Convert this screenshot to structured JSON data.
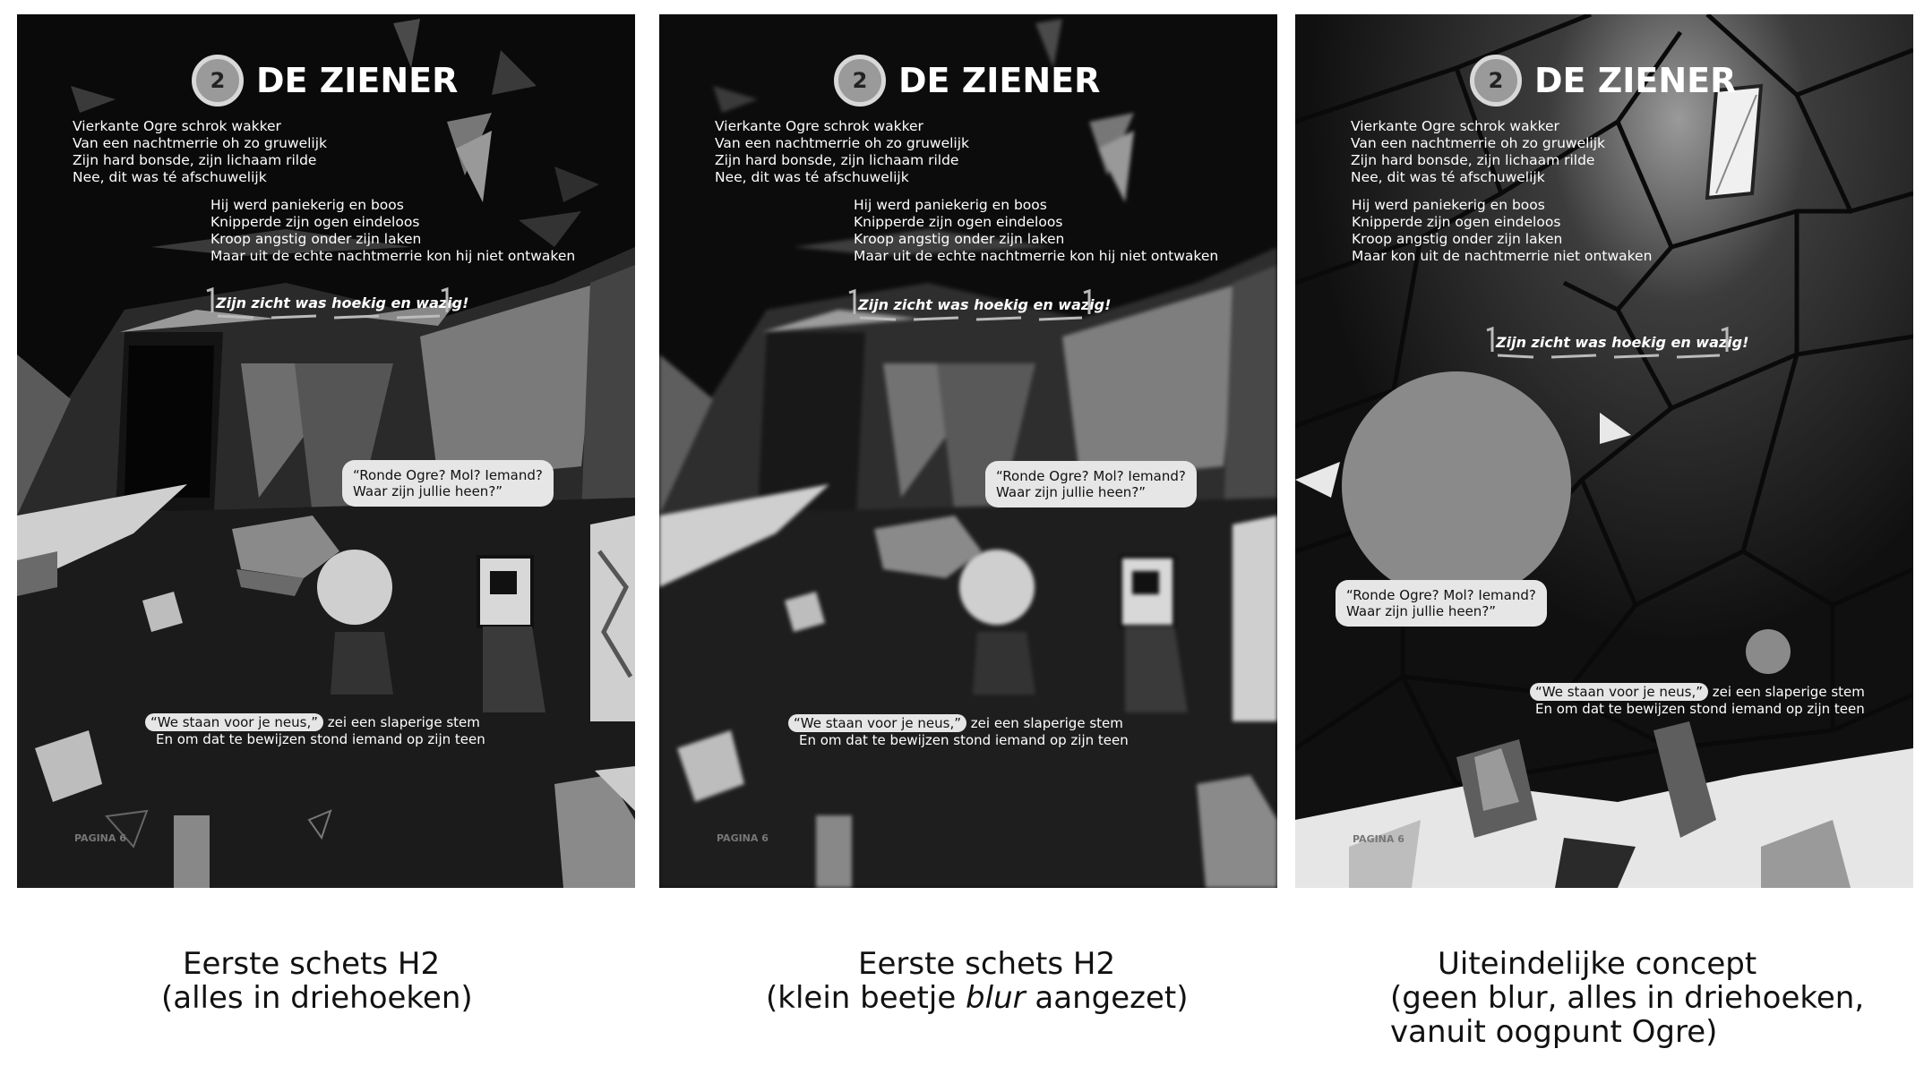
{
  "panels": [
    {
      "title": "DE ZIENER",
      "chapter": "2",
      "verse1": [
        "Vierkante Ogre schrok wakker",
        "Van een nachtmerrie oh zo gruwelijk",
        "Zijn hard bonsde, zijn lichaam rilde",
        "Nee, dit was té afschuwelijk"
      ],
      "verse2": [
        "Hij werd paniekerig en boos",
        "Knipperde zijn ogen eindeloos",
        "Kroop angstig onder zijn laken",
        "Maar uit de echte nachtmerrie kon hij niet ontwaken"
      ],
      "caption": "Zijn zicht was hoekig en wazig!",
      "bubble": [
        "“Ronde Ogre? Mol? Iemand?",
        "Waar zijn jullie heen?”"
      ],
      "narr_highlight": "“We staan voor je neus,”",
      "narr_line1_rest": " zei een slaperige stem",
      "narr_line2": "En om dat te bewijzen stond iemand op zijn teen",
      "page": "PAGINA 6"
    },
    {
      "title": "DE ZIENER",
      "chapter": "2",
      "verse1": [
        "Vierkante Ogre schrok wakker",
        "Van een nachtmerrie oh zo gruwelijk",
        "Zijn hard bonsde, zijn lichaam rilde",
        "Nee, dit was té afschuwelijk"
      ],
      "verse2": [
        "Hij werd paniekerig en boos",
        "Knipperde zijn ogen eindeloos",
        "Kroop angstig onder zijn laken",
        "Maar uit de echte nachtmerrie kon hij niet ontwaken"
      ],
      "caption": "Zijn zicht was hoekig en wazig!",
      "bubble": [
        "“Ronde Ogre? Mol? Iemand?",
        "Waar zijn jullie heen?”"
      ],
      "narr_highlight": "“We staan voor je neus,”",
      "narr_line1_rest": " zei een slaperige stem",
      "narr_line2": "En om dat te bewijzen stond iemand op zijn teen",
      "page": "PAGINA 6"
    },
    {
      "title": "DE ZIENER",
      "chapter": "2",
      "verse1": [
        "Vierkante Ogre schrok wakker",
        "Van een nachtmerrie oh zo gruwelijk",
        "Zijn hard bonsde, zijn lichaam rilde",
        "Nee, dit was té afschuwelijk"
      ],
      "verse2": [
        "Hij werd paniekerig en boos",
        "Knipperde zijn ogen eindeloos",
        "Kroop angstig onder zijn laken",
        "Maar kon uit de nachtmerrie niet ontwaken"
      ],
      "caption": "Zijn zicht was hoekig en wazig!",
      "bubble": [
        "“Ronde Ogre? Mol? Iemand?",
        "Waar zijn jullie heen?”"
      ],
      "narr_highlight": "“We staan voor je neus,”",
      "narr_line1_rest": " zei een slaperige stem",
      "narr_line2": "En om dat te bewijzen stond iemand op zijn teen",
      "page": "PAGINA 6"
    }
  ],
  "labels": [
    {
      "line1": "Eerste schets H2",
      "line2": "(alles in driehoeken)"
    },
    {
      "line1": "Eerste schets H2",
      "line2_pre": "(klein beetje ",
      "line2_em": "blur",
      "line2_post": " aangezet)"
    },
    {
      "line1": "Uiteindelijke concept",
      "line2": "(geen blur, alles in driehoeken,",
      "line3": "vanuit oogpunt Ogre)"
    }
  ]
}
